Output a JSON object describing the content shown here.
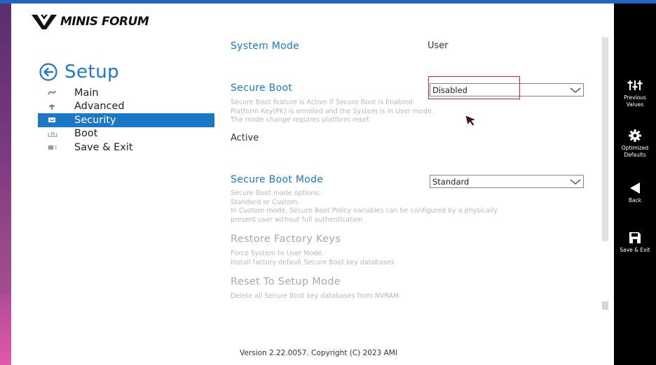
{
  "logo": {
    "text": "MINIS FORUM"
  },
  "setup": {
    "title": "Setup"
  },
  "nav": {
    "items": [
      {
        "label": "Main",
        "icon": "main-icon"
      },
      {
        "label": "Advanced",
        "icon": "advanced-icon"
      },
      {
        "label": "Security",
        "icon": "security-icon",
        "selected": true
      },
      {
        "label": "Boot",
        "icon": "boot-icon"
      },
      {
        "label": "Save & Exit",
        "icon": "save-exit-icon"
      }
    ]
  },
  "settings": {
    "system_mode": {
      "label": "System Mode",
      "value": "User"
    },
    "secure_boot": {
      "label": "Secure Boot",
      "value": "Disabled",
      "help": "Secure Boot feature is Active if Secure Boot is Enabled,\nPlatform Key(PK) is enrolled and the System is in User mode.\nThe mode change requires platform reset",
      "status": "Active"
    },
    "secure_boot_mode": {
      "label": "Secure Boot Mode",
      "value": "Standard",
      "help": "Secure Boot mode options:\nStandard or Custom.\nIn Custom mode, Secure Boot Policy variables can be configured by a physically\npresent user without full authentication"
    },
    "restore_factory_keys": {
      "label": "Restore Factory Keys",
      "help": "Force System to User Mode.\nInstall factory default Secure Boot key databases"
    },
    "reset_to_setup_mode": {
      "label": "Reset To Setup Mode",
      "help": "Delete all Secure Boot key databases from NVRAM"
    }
  },
  "footer": {
    "version": "Version 2.22.0057. Copyright (C) 2023 AMI"
  },
  "rightbar": {
    "previous_values": "Previous\nValues",
    "optimized_defaults": "Optimized\nDefaults",
    "back": "Back",
    "save_exit": "Save & Exit"
  },
  "colors": {
    "accent": "#1b78c6",
    "highlight": "#e02020",
    "sidebar": "#000000"
  }
}
